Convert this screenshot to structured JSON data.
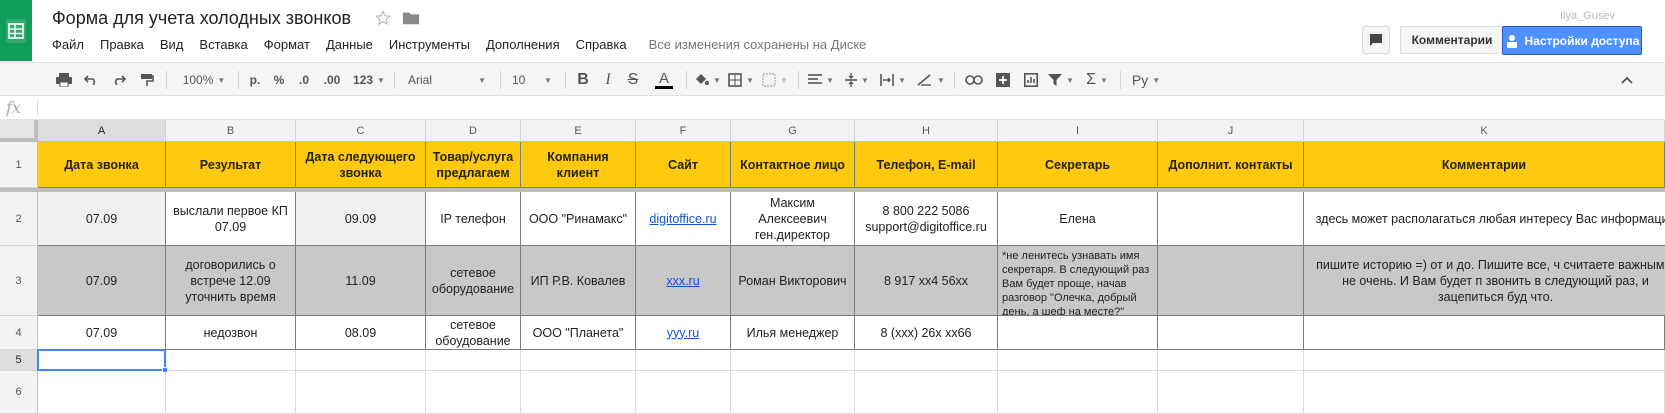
{
  "app": {
    "title": "Форма для учета холодных звонков",
    "user_name": "Ilya_Gusev",
    "menu": [
      "Файл",
      "Правка",
      "Вид",
      "Вставка",
      "Формат",
      "Данные",
      "Инструменты",
      "Дополнения",
      "Справка"
    ],
    "save_status": "Все изменения сохранены на Диске",
    "comments_button": "Комментарии",
    "share_button": "Настройки доступа"
  },
  "toolbar": {
    "zoom": "100%",
    "currency": "р.",
    "percent": "%",
    "decrease_decimals": ".0",
    "increase_decimals": ".00",
    "more_formats": "123",
    "font": "Arial",
    "font_size": "10",
    "input_tools": "Ру"
  },
  "formula_bar": {
    "fx": "fx",
    "value": ""
  },
  "columns": [
    "A",
    "B",
    "C",
    "D",
    "E",
    "F",
    "G",
    "H",
    "I",
    "J",
    "K"
  ],
  "rows": [
    "1",
    "2",
    "3",
    "4",
    "5",
    "6"
  ],
  "header_row": [
    "Дата звонка",
    "Результат",
    "Дата следующего звонка",
    "Товар/услуга предлагаем",
    "Компания клиент",
    "Сайт",
    "Контактное лицо",
    "Телефон, E-mail",
    "Секретарь",
    "Дополнит. контакты",
    "Комментарии"
  ],
  "data_rows": [
    [
      "07.09",
      "выслали первое КП 07.09",
      "09.09",
      "IP телефон",
      "ООО \"Ринамакс\"",
      "digitoffice.ru",
      "Максим Алексеевич ген.директор",
      "8 800 222 5086 support@digitoffice.ru",
      "Елена",
      "",
      "здесь может располагаться любая интересу Вас информация"
    ],
    [
      "07.09",
      "договорились о встрече 12.09 уточнить время",
      "11.09",
      "сетевое оборудование",
      "ИП Р.В. Ковалев",
      "xxx.ru",
      "Роман Викторович",
      "8 917 xx4 56xx",
      "*не ленитесь узнавать имя секретаря. В следующий раз Вам будет проще, начав разговор \"Олечка, добрый день, а шеф на месте?\"",
      "",
      "пишите историю =) от и до. Пишите все, ч считаете важным и не очень. И Вам будет п звонить в следующий раз, и зацепиться буд что."
    ],
    [
      "07.09",
      "недозвон",
      "08.09",
      "сетевое обоудование",
      "ООО \"Планета\"",
      "yyy.ru",
      "Илья менеджер",
      "8 (xxx) 26x xx66",
      "",
      "",
      ""
    ]
  ],
  "selected_cell": "A5",
  "colors": {
    "header_fill": "#ffc90e",
    "row3_fill": "#c8c8c8",
    "brand_green": "#0f9d58",
    "share_blue": "#4d90fe",
    "link": "#1155cc"
  }
}
